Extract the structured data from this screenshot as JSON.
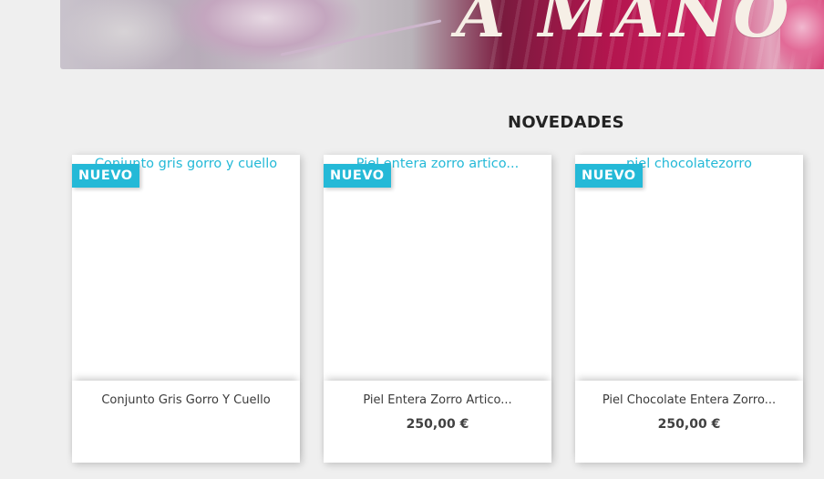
{
  "banner": {
    "text": "A MANO"
  },
  "section": {
    "title": "NOVEDADES"
  },
  "products": [
    {
      "badge": "NUEVO",
      "image_alt": "Conjunto gris gorro y cuello",
      "name": "Conjunto Gris Gorro Y Cuello",
      "price": ""
    },
    {
      "badge": "NUEVO",
      "image_alt": "Piel entera zorro artico...",
      "name": "Piel Entera Zorro Artico...",
      "price": "250,00 €"
    },
    {
      "badge": "NUEVO",
      "image_alt": "piel chocolatezorro",
      "name": "Piel Chocolate Entera Zorro...",
      "price": "250,00 €"
    }
  ],
  "colors": {
    "accent": "#24b9d7",
    "background": "#efefef",
    "card": "#ffffff",
    "text": "#414141"
  }
}
